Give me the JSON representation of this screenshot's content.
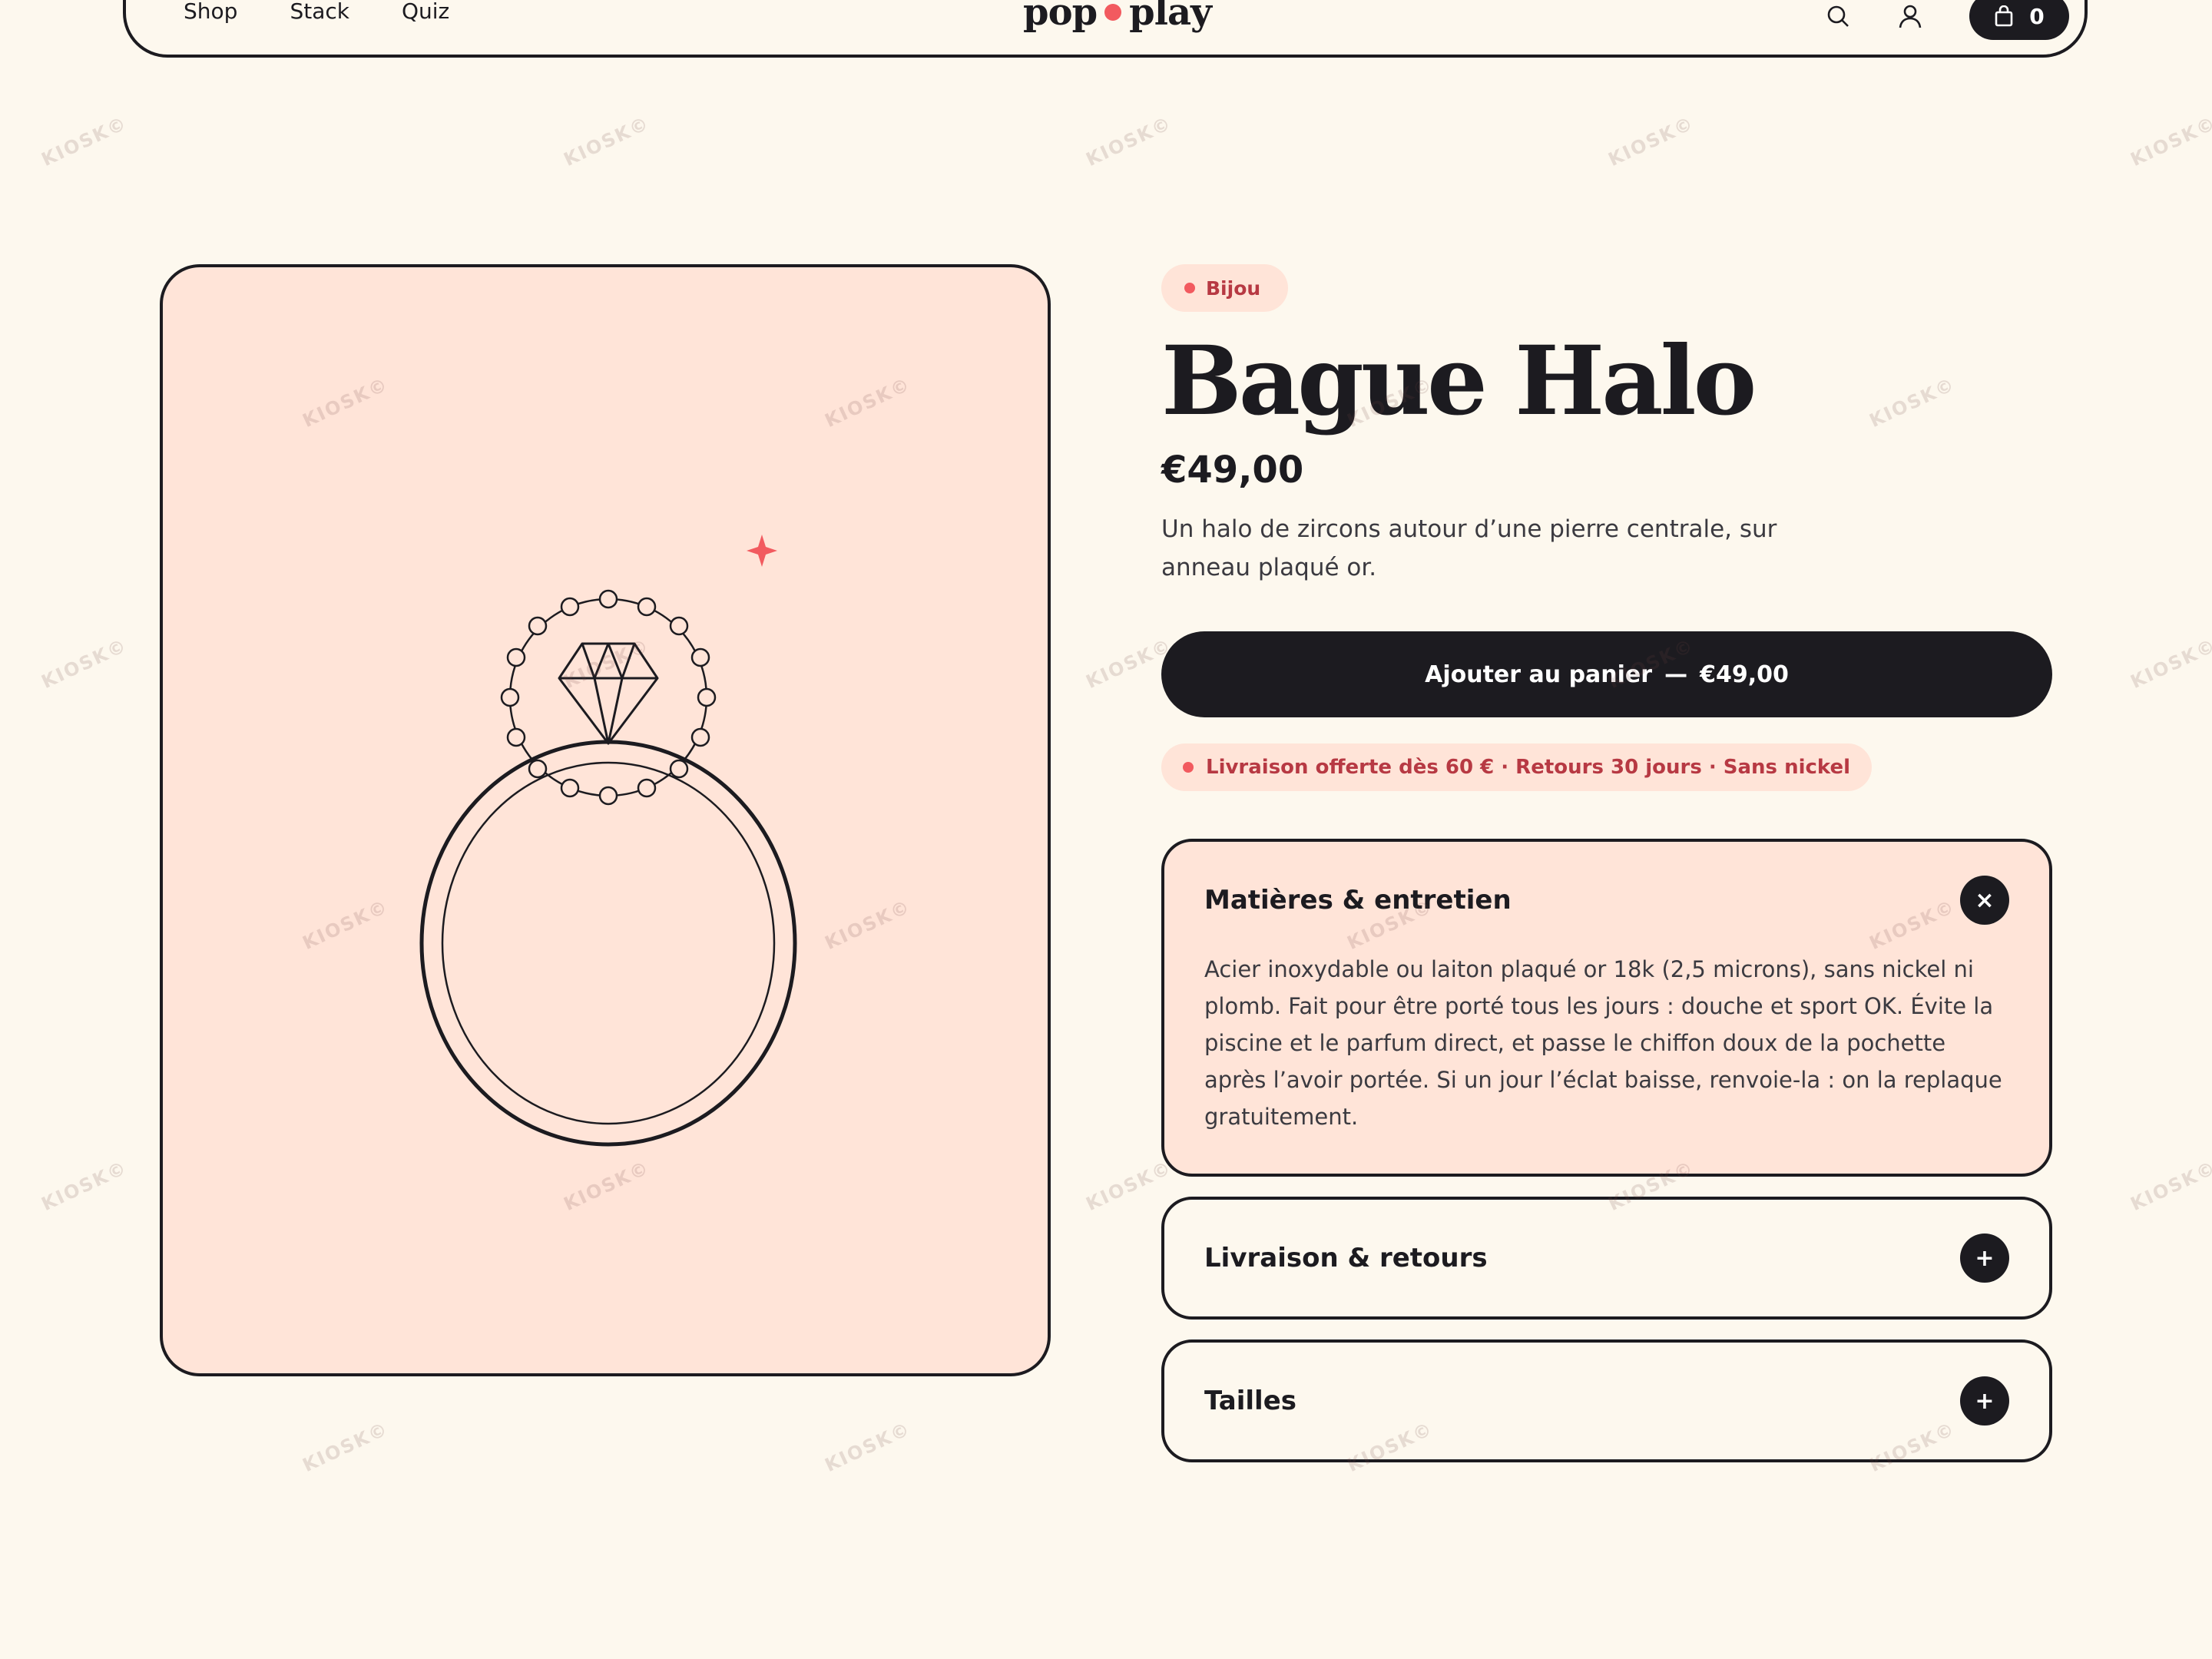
{
  "header": {
    "nav": [
      "Shop",
      "Stack",
      "Quiz"
    ],
    "logo_left": "pop",
    "logo_right": "play",
    "cart_count": "0"
  },
  "product": {
    "category": "Bijou",
    "name": "Bague Halo",
    "price": "€49,00",
    "description": "Un halo de zircons autour d’une pierre centrale, sur anneau plaqué or.",
    "add_to_cart_label": "Ajouter au panier",
    "add_to_cart_sep": "—",
    "add_to_cart_price": "€49,00",
    "perks": "Livraison offerte dès 60 € · Retours 30 jours · Sans nickel"
  },
  "accordion": [
    {
      "title": "Matières & entretien",
      "toggle": "×",
      "expanded": true,
      "body": "Acier inoxydable ou laiton plaqué or 18k (2,5 microns), sans nickel ni plomb. Fait pour être porté tous les jours : douche et sport OK. Évite la piscine et le parfum direct, et passe le chiffon doux de la pochette après l’avoir portée. Si un jour l’éclat baisse, renvoie-la : on la replaque gratuitement."
    },
    {
      "title": "Livraison & retours",
      "toggle": "+",
      "expanded": false
    },
    {
      "title": "Tailles",
      "toggle": "+",
      "expanded": false
    }
  ],
  "watermark": "KIOSK©",
  "colors": {
    "background": "#fdf8ee",
    "ink": "#1c1b20",
    "blush": "#ffe4d8",
    "accent": "#f25a5f",
    "accent_text": "#b73943"
  },
  "icons": {
    "search": "search-icon",
    "account": "user-icon",
    "cart": "bag-icon",
    "sparkle": "sparkle-icon"
  }
}
